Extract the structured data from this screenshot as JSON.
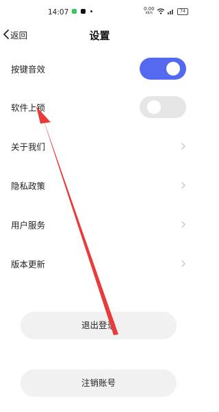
{
  "status_bar": {
    "time": "14:07",
    "network_speed": "0.00",
    "network_unit": "KB/S",
    "battery": "74"
  },
  "nav": {
    "back_label": "返回",
    "title": "设置"
  },
  "settings": [
    {
      "label": "按键音效",
      "type": "toggle",
      "on": true
    },
    {
      "label": "软件上锁",
      "type": "toggle",
      "on": false
    },
    {
      "label": "关于我们",
      "type": "link"
    },
    {
      "label": "隐私政策",
      "type": "link"
    },
    {
      "label": "用户服务",
      "type": "link"
    },
    {
      "label": "版本更新",
      "type": "link"
    }
  ],
  "buttons": {
    "logout": "退出登录",
    "delete_account": "注销账号"
  },
  "colors": {
    "accent": "#5468f0",
    "toggle_off": "#e6e6e6",
    "annotation_arrow": "#ea3b3b",
    "button_bg": "#f1f1f1",
    "status_app_green": "#34c759"
  }
}
